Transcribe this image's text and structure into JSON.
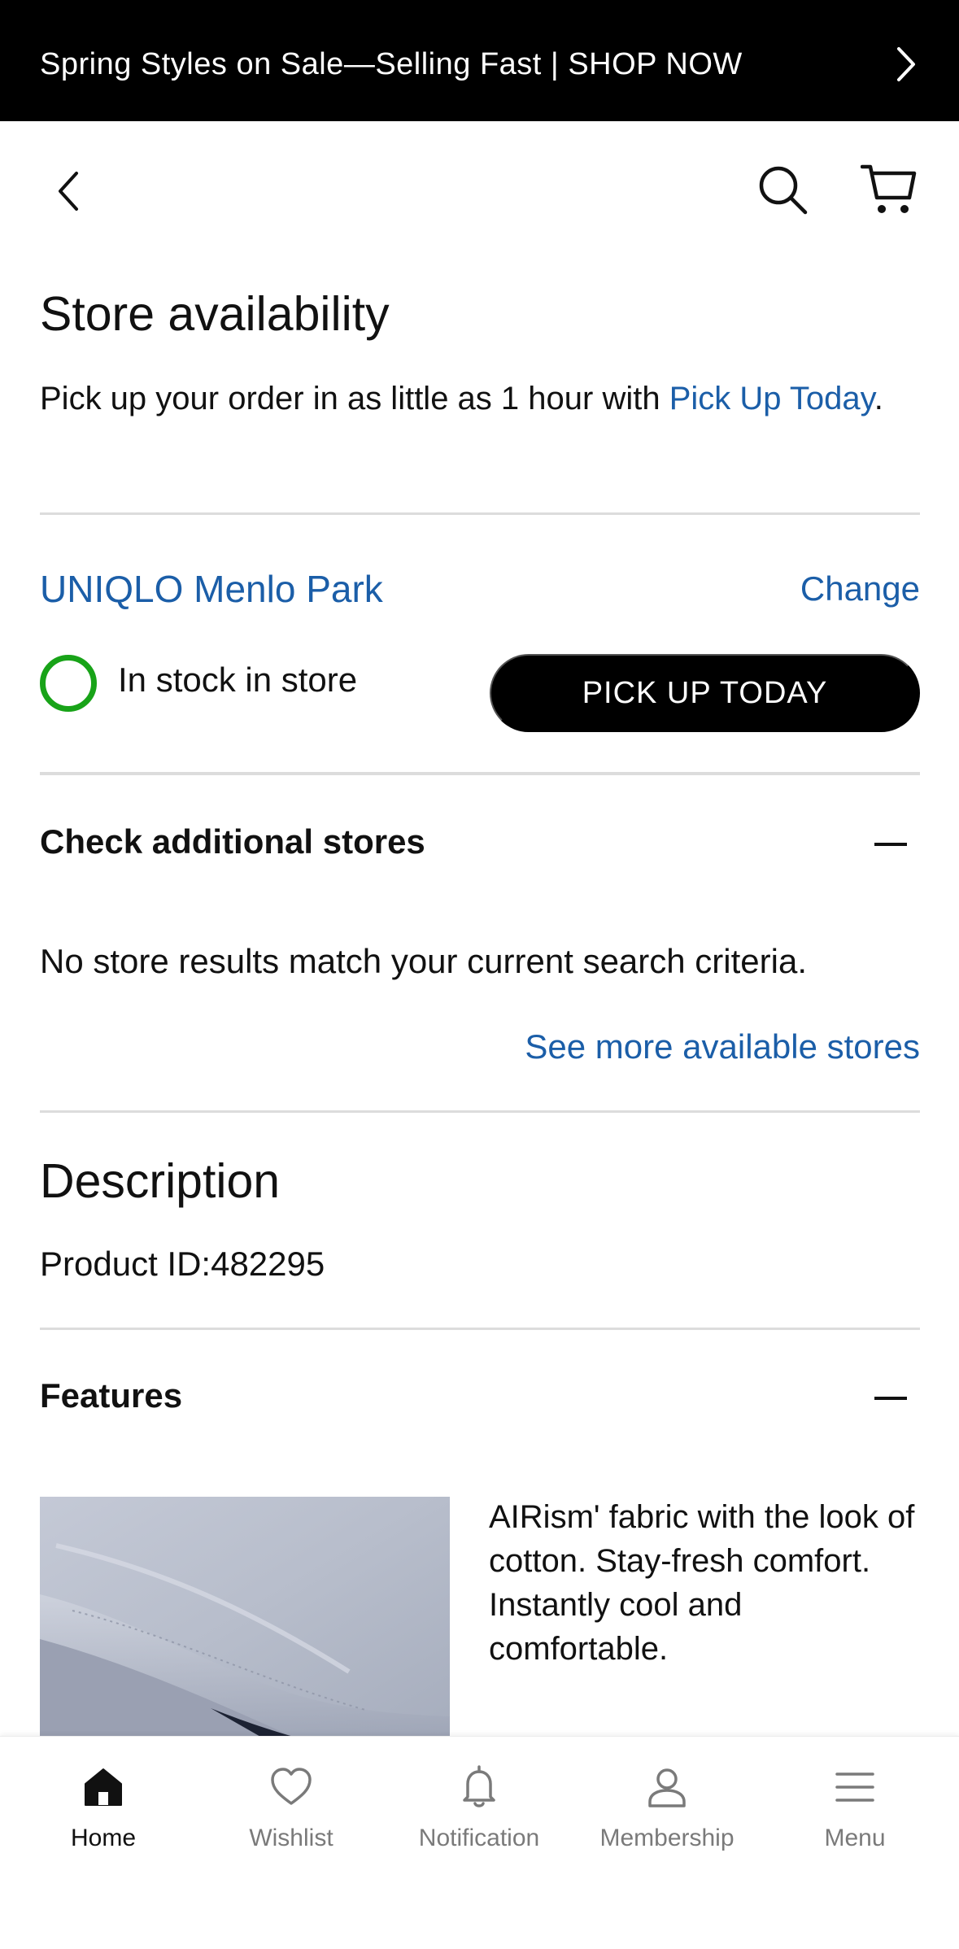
{
  "promo": {
    "text": "Spring Styles on Sale—Selling Fast | SHOP NOW"
  },
  "header": {
    "back_icon": "chevron-left-icon",
    "search_icon": "search-icon",
    "cart_icon": "cart-icon"
  },
  "store_availability": {
    "title": "Store availability",
    "intro_text": "Pick up your order in as little as 1 hour with ",
    "intro_link": "Pick Up Today",
    "intro_end": "."
  },
  "store": {
    "name": "UNIQLO Menlo Park",
    "change_label": "Change",
    "stock_status": "In stock in store",
    "stock_color": "#18a318",
    "pickup_button": "PICK UP TODAY"
  },
  "additional_stores": {
    "title": "Check additional stores",
    "no_results": "No store results match your current search criteria.",
    "see_more": "See more available stores"
  },
  "description": {
    "title": "Description",
    "product_id": "Product ID:482295"
  },
  "features": {
    "title": "Features",
    "text": "AIRism' fabric with the look of cotton. Stay-fresh comfort. Instantly cool and comfortable."
  },
  "tabbar": {
    "items": [
      {
        "label": "Home",
        "icon": "home-icon",
        "active": true
      },
      {
        "label": "Wishlist",
        "icon": "heart-icon",
        "active": false
      },
      {
        "label": "Notification",
        "icon": "bell-icon",
        "active": false
      },
      {
        "label": "Membership",
        "icon": "person-icon",
        "active": false
      },
      {
        "label": "Menu",
        "icon": "hamburger-menu-icon",
        "active": false
      }
    ]
  },
  "colors": {
    "link": "#1b5ea8",
    "accent_black": "#000000"
  }
}
